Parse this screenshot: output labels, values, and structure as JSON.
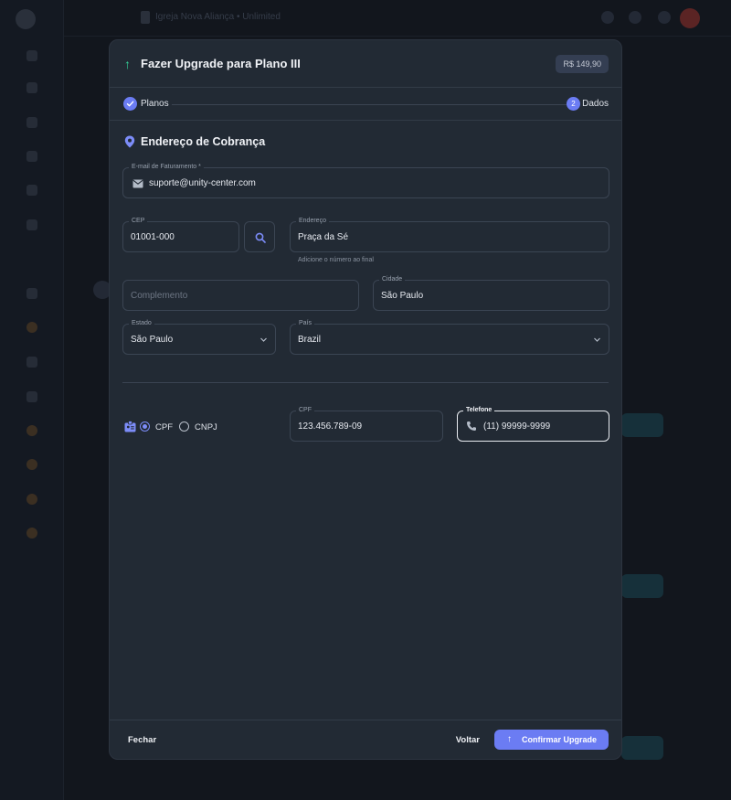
{
  "background": {
    "app_title": "Igreja Nova Aliança • Unlimited",
    "accent": "#6b7cf3"
  },
  "modal": {
    "title": "Fazer Upgrade para Plano III",
    "price": "R$ 149,90",
    "steps": [
      {
        "label": "Planos",
        "state": "done"
      },
      {
        "number": "2",
        "label": "Dados",
        "state": "active"
      }
    ],
    "section_title": "Endereço de Cobrança",
    "fields": {
      "email": {
        "label": "E-mail de Faturamento *",
        "value": "suporte@unity-center.com"
      },
      "cep": {
        "label": "CEP",
        "value": "01001-000"
      },
      "endereco": {
        "label": "Endereço",
        "value": "Praça da Sé",
        "helper": "Adicione o número ao final"
      },
      "complemento": {
        "placeholder": "Complemento"
      },
      "cidade": {
        "label": "Cidade",
        "value": "São Paulo"
      },
      "estado": {
        "label": "Estado",
        "value": "São Paulo"
      },
      "pais": {
        "label": "País",
        "value": "Brazil"
      },
      "cpf": {
        "label": "CPF",
        "value": "123.456.789-09"
      },
      "telefone": {
        "label": "Telefone",
        "value": "(11) 99999-9999"
      }
    },
    "doc_type": {
      "options": [
        "CPF",
        "CNPJ"
      ],
      "selected": "CPF"
    },
    "footer": {
      "close_label": "Fechar",
      "back_label": "Voltar",
      "confirm_label": "Confirmar Upgrade"
    }
  }
}
